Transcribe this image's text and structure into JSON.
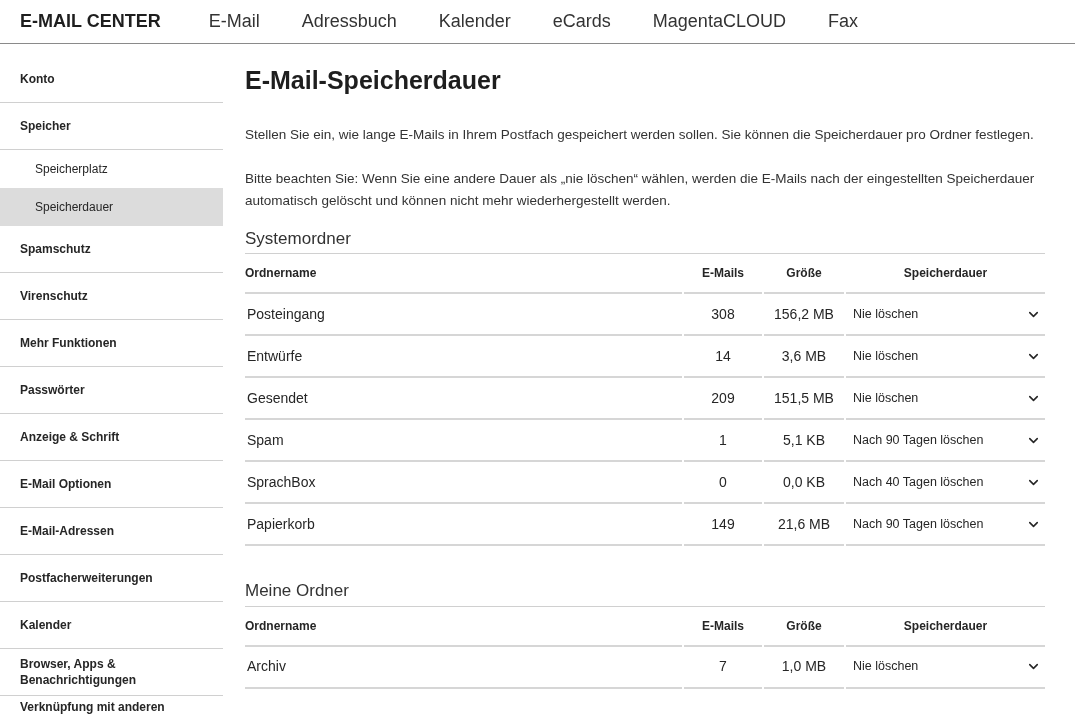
{
  "header": {
    "brand": "E-MAIL CENTER",
    "nav": [
      "E-Mail",
      "Adressbuch",
      "Kalender",
      "eCards",
      "MagentaCLOUD",
      "Fax"
    ]
  },
  "sidebar": {
    "items": [
      {
        "label": "Konto",
        "kind": "main",
        "selected": false
      },
      {
        "label": "Speicher",
        "kind": "main",
        "selected": false
      },
      {
        "label": "Speicherplatz",
        "kind": "sub",
        "selected": false
      },
      {
        "label": "Speicherdauer",
        "kind": "sub",
        "selected": true
      },
      {
        "label": "Spamschutz",
        "kind": "main",
        "selected": false
      },
      {
        "label": "Virenschutz",
        "kind": "main",
        "selected": false
      },
      {
        "label": "Mehr Funktionen",
        "kind": "main",
        "selected": false
      },
      {
        "label": "Passwörter",
        "kind": "main",
        "selected": false
      },
      {
        "label": "Anzeige & Schrift",
        "kind": "main",
        "selected": false
      },
      {
        "label": "E-Mail Optionen",
        "kind": "main",
        "selected": false
      },
      {
        "label": "E-Mail-Adressen",
        "kind": "main",
        "selected": false
      },
      {
        "label": "Postfacherweiterungen",
        "kind": "main",
        "selected": false
      },
      {
        "label": "Kalender",
        "kind": "main",
        "selected": false
      },
      {
        "label": "Browser, Apps & Benachrichtigungen",
        "kind": "main",
        "selected": false
      },
      {
        "label": "Verknüpfung mit anderen",
        "kind": "main",
        "selected": false
      }
    ]
  },
  "page": {
    "title": "E-Mail-Speicherdauer",
    "paragraphs": [
      "Stellen Sie ein, wie lange E-Mails in Ihrem Postfach gespeichert werden sollen. Sie können die Speicherdauer pro Ordner festlegen.",
      "Bitte beachten Sie: Wenn Sie eine andere Dauer als „nie löschen“ wählen, werden die E-Mails nach der eingestellten Speicherdauer automatisch gelöscht und können nicht mehr wiederhergestellt werden."
    ],
    "sections": [
      {
        "title": "Systemordner",
        "columns": [
          "Ordnername",
          "E-Mails",
          "Größe",
          "Speicherdauer"
        ],
        "rows": [
          {
            "name": "Posteingang",
            "emails": "308",
            "size": "156,2 MB",
            "retention": "Nie löschen"
          },
          {
            "name": "Entwürfe",
            "emails": "14",
            "size": "3,6 MB",
            "retention": "Nie löschen"
          },
          {
            "name": "Gesendet",
            "emails": "209",
            "size": "151,5 MB",
            "retention": "Nie löschen"
          },
          {
            "name": "Spam",
            "emails": "1",
            "size": "5,1 KB",
            "retention": "Nach 90 Tagen löschen"
          },
          {
            "name": "SprachBox",
            "emails": "0",
            "size": "0,0 KB",
            "retention": "Nach 40 Tagen löschen"
          },
          {
            "name": "Papierkorb",
            "emails": "149",
            "size": "21,6 MB",
            "retention": "Nach 90 Tagen löschen"
          }
        ]
      },
      {
        "title": "Meine Ordner",
        "columns": [
          "Ordnername",
          "E-Mails",
          "Größe",
          "Speicherdauer"
        ],
        "rows": [
          {
            "name": "Archiv",
            "emails": "7",
            "size": "1,0 MB",
            "retention": "Nie löschen"
          }
        ]
      }
    ]
  }
}
